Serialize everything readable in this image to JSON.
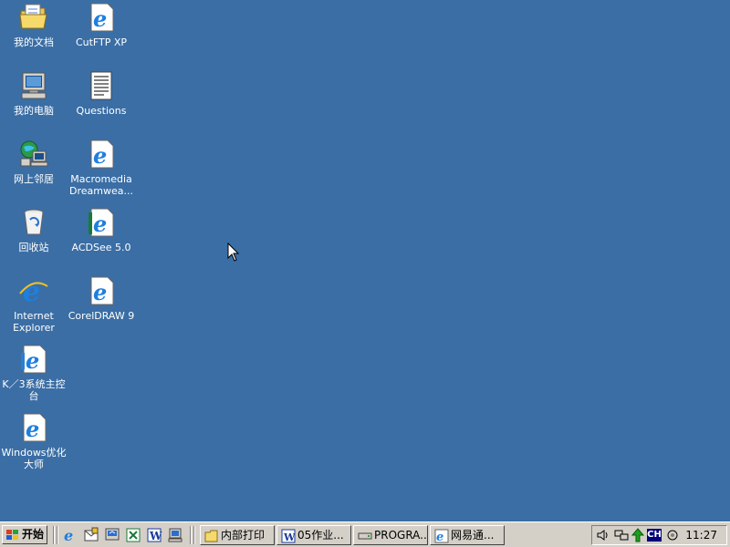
{
  "desktop": {
    "icons": [
      {
        "label": "我的文档",
        "icon": "folder-documents-icon"
      },
      {
        "label": "CutFTP XP",
        "icon": "ie-document-icon"
      },
      {
        "label": "我的电脑",
        "icon": "computer-icon"
      },
      {
        "label": "Questions",
        "icon": "text-document-icon"
      },
      {
        "label": "网上邻居",
        "icon": "network-icon"
      },
      {
        "label": "Macromedia Dreamwea...",
        "icon": "ie-document-icon"
      },
      {
        "label": "回收站",
        "icon": "recycle-bin-icon"
      },
      {
        "label": "ACDSee 5.0",
        "icon": "ie-document-icon"
      },
      {
        "label": "Internet Explorer",
        "icon": "internet-explorer-icon"
      },
      {
        "label": "CorelDRAW 9",
        "icon": "ie-document-icon"
      },
      {
        "label": "K／3系统主控台",
        "icon": "ie-document-icon"
      },
      {
        "label": "Windows优化大师",
        "icon": "ie-document-icon"
      }
    ]
  },
  "taskbar": {
    "start_label": "开始",
    "tasks": [
      {
        "label": "内部打印",
        "icon": "folder-icon"
      },
      {
        "label": "05作业...",
        "icon": "word-icon"
      },
      {
        "label": "PROGRA...",
        "icon": "drive-icon"
      },
      {
        "label": "网易通...",
        "icon": "ie-icon"
      }
    ],
    "tray": {
      "ime": "CH",
      "clock": "11:27"
    }
  },
  "colors": {
    "desktop": "#3a6ea5",
    "taskbar": "#d4d0c8"
  }
}
